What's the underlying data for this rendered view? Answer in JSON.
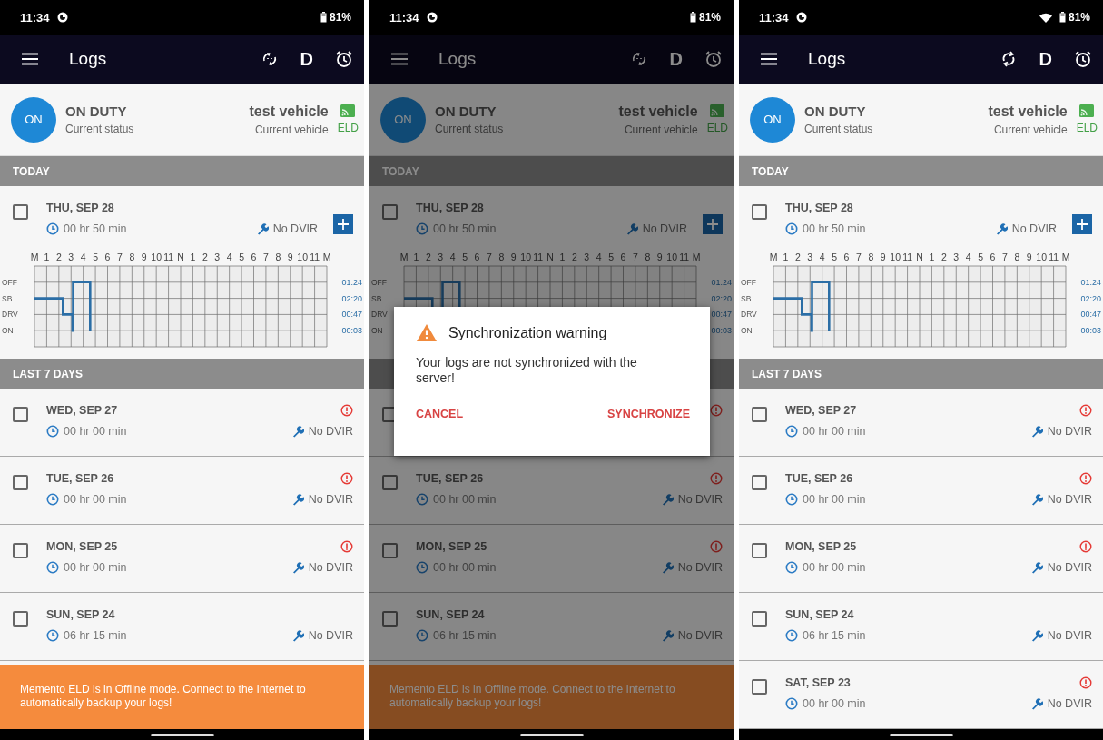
{
  "screens": [
    {
      "status_bar": {
        "time": "11:34",
        "battery": "81%",
        "wifi": false
      },
      "app_bar": {
        "title": "Logs",
        "sync_enabled": false,
        "driver": "D"
      },
      "status": {
        "badge": "ON",
        "title": "ON DUTY",
        "subtitle": "Current status",
        "vehicle": "test vehicle",
        "vehicle_label": "Current vehicle",
        "eld": "ELD"
      },
      "today": {
        "header": "TODAY",
        "checked": false,
        "date": "THU, SEP 28",
        "duration": "00 hr 50 min",
        "dvir": "No DVIR",
        "hour_labels": [
          "M",
          "1",
          "2",
          "3",
          "4",
          "5",
          "6",
          "7",
          "8",
          "9",
          "10",
          "11",
          "N",
          "1",
          "2",
          "3",
          "4",
          "5",
          "6",
          "7",
          "8",
          "9",
          "10",
          "11",
          "M"
        ],
        "status_labels": [
          "OFF",
          "SB",
          "DRV",
          "ON"
        ],
        "totals": [
          "01:24",
          "02:20",
          "00:47",
          "00:03"
        ]
      },
      "last7": {
        "header": "LAST 7 DAYS",
        "rows": [
          {
            "checked": false,
            "date": "WED, SEP 27",
            "duration": "00 hr 00 min",
            "dvir": "No DVIR",
            "warning": true
          },
          {
            "checked": false,
            "date": "TUE, SEP 26",
            "duration": "00 hr 00 min",
            "dvir": "No DVIR",
            "warning": true
          },
          {
            "checked": false,
            "date": "MON, SEP 25",
            "duration": "00 hr 00 min",
            "dvir": "No DVIR",
            "warning": true
          },
          {
            "checked": false,
            "date": "SUN, SEP 24",
            "duration": "06 hr 15 min",
            "dvir": "No DVIR",
            "warning": false
          }
        ]
      },
      "banner": "Memento ELD is in Offline mode. Connect to the Internet to automatically backup your logs!"
    },
    {
      "status_bar": {
        "time": "11:34",
        "battery": "81%",
        "wifi": false
      },
      "app_bar": {
        "title": "Logs",
        "sync_enabled": false,
        "driver": "D"
      },
      "status": {
        "badge": "ON",
        "title": "ON DUTY",
        "subtitle": "Current status",
        "vehicle": "test vehicle",
        "vehicle_label": "Current vehicle",
        "eld": "ELD"
      },
      "today": {
        "header": "TODAY",
        "checked": false,
        "date": "THU, SEP 28",
        "duration": "00 hr 50 min",
        "dvir": "No DVIR",
        "hour_labels": [
          "M",
          "1",
          "2",
          "3",
          "4",
          "5",
          "6",
          "7",
          "8",
          "9",
          "10",
          "11",
          "N",
          "1",
          "2",
          "3",
          "4",
          "5",
          "6",
          "7",
          "8",
          "9",
          "10",
          "11",
          "M"
        ],
        "status_labels": [
          "OFF",
          "SB",
          "DRV",
          "ON"
        ],
        "totals": [
          "01:24",
          "02:20",
          "00:47",
          "00:03"
        ]
      },
      "last7": {
        "rows": [
          {
            "checked": false,
            "warning": true
          },
          {
            "checked": false,
            "date": "TUE, SEP 26",
            "duration": "00 hr 00 min",
            "dvir": "No DVIR",
            "warning": true
          },
          {
            "checked": false,
            "date": "MON, SEP 25",
            "duration": "00 hr 00 min",
            "dvir": "No DVIR",
            "warning": true
          },
          {
            "checked": false,
            "date": "SUN, SEP 24",
            "duration": "06 hr 15 min",
            "dvir": "No DVIR",
            "warning": false
          }
        ]
      },
      "banner": "Memento ELD is in Offline mode. Connect to the Internet to automatically backup your logs!",
      "dialog": {
        "title": "Synchronization warning",
        "message": "Your logs are not synchronized with the server!",
        "buttons": [
          "CANCEL",
          "SYNCHRONIZE"
        ]
      }
    },
    {
      "status_bar": {
        "time": "11:34",
        "battery": "81%",
        "wifi": true
      },
      "app_bar": {
        "title": "Logs",
        "sync_enabled": true,
        "driver": "D"
      },
      "status": {
        "badge": "ON",
        "title": "ON DUTY",
        "subtitle": "Current status",
        "vehicle": "test vehicle",
        "vehicle_label": "Current vehicle",
        "eld": "ELD"
      },
      "today": {
        "header": "TODAY",
        "checked": false,
        "date": "THU, SEP 28",
        "duration": "00 hr 50 min",
        "dvir": "No DVIR",
        "hour_labels": [
          "M",
          "1",
          "2",
          "3",
          "4",
          "5",
          "6",
          "7",
          "8",
          "9",
          "10",
          "11",
          "N",
          "1",
          "2",
          "3",
          "4",
          "5",
          "6",
          "7",
          "8",
          "9",
          "10",
          "11",
          "M"
        ],
        "status_labels": [
          "OFF",
          "SB",
          "DRV",
          "ON"
        ],
        "totals": [
          "01:24",
          "02:20",
          "00:47",
          "00:03"
        ]
      },
      "last7": {
        "header": "LAST 7 DAYS",
        "rows": [
          {
            "checked": false,
            "date": "WED, SEP 27",
            "duration": "00 hr 00 min",
            "dvir": "No DVIR",
            "warning": true
          },
          {
            "checked": false,
            "date": "TUE, SEP 26",
            "duration": "00 hr 00 min",
            "dvir": "No DVIR",
            "warning": true
          },
          {
            "checked": false,
            "date": "MON, SEP 25",
            "duration": "00 hr 00 min",
            "dvir": "No DVIR",
            "warning": true
          },
          {
            "checked": false,
            "date": "SUN, SEP 24",
            "duration": "06 hr 15 min",
            "dvir": "No DVIR",
            "warning": false
          },
          {
            "checked": false,
            "date": "SAT, SEP 23",
            "duration": "00 hr 00 min",
            "dvir": "No DVIR",
            "warning": true
          }
        ]
      }
    }
  ]
}
